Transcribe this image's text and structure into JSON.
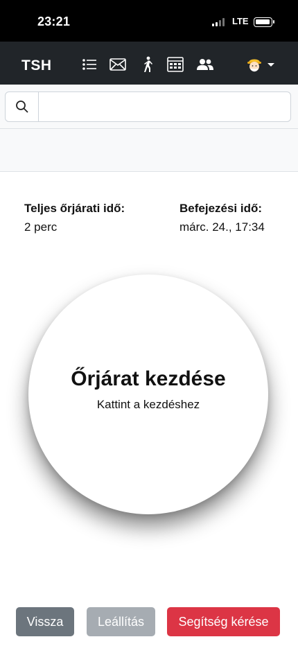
{
  "status_bar": {
    "time": "23:21",
    "network": "LTE"
  },
  "navbar": {
    "brand": "TSH",
    "icons": [
      "list-icon",
      "envelope-icon",
      "walking-person-icon",
      "calculator-icon",
      "people-icon"
    ],
    "avatar": "avatar-icon"
  },
  "search": {
    "value": "",
    "placeholder": ""
  },
  "patrol": {
    "total_label": "Teljes őrjárati idő:",
    "total_value": "2 perc",
    "end_label": "Befejezési idő:",
    "end_value": "márc. 24., 17:34",
    "start_title": "Őrjárat kezdése",
    "start_subtitle": "Kattint a kezdéshez"
  },
  "actions": {
    "back": "Vissza",
    "stop": "Leállítás",
    "help": "Segítség kérése"
  },
  "colors": {
    "navbar": "#212529",
    "back": "#6c757d",
    "stop": "#a6acb2",
    "help": "#dc3545"
  }
}
